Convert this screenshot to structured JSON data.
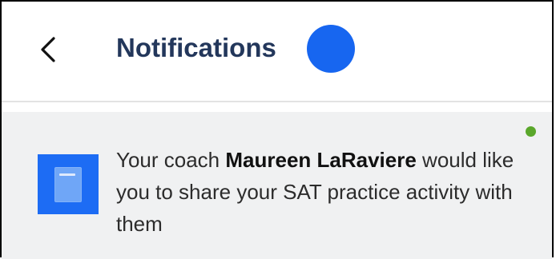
{
  "header": {
    "title": "Notifications",
    "accent_color": "#1766f0",
    "back_icon": "chevron-left-icon"
  },
  "notification": {
    "icon": "document-icon",
    "text_prefix": "Your coach ",
    "coach_name": "Maureen LaRaviere",
    "text_suffix": " would like you to share your SAT practice activity with them",
    "unread": true,
    "unread_color": "#5aa72b",
    "background_color": "#f0f1f2"
  }
}
